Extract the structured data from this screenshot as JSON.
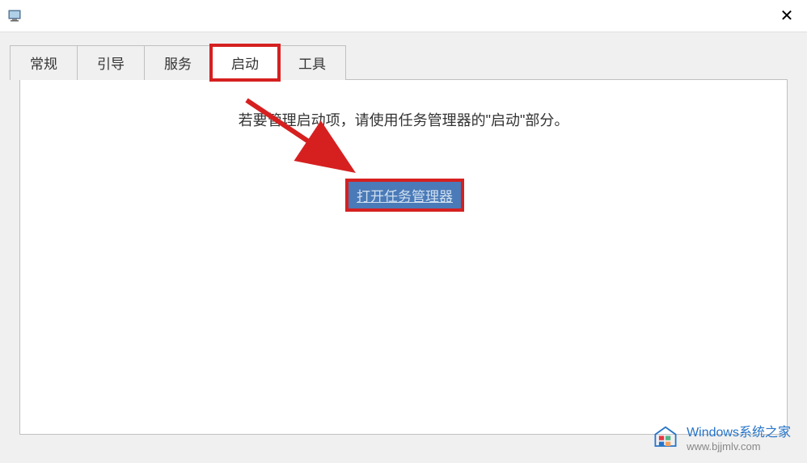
{
  "titlebar": {
    "close_label": "✕"
  },
  "tabs": {
    "general": "常规",
    "boot": "引导",
    "services": "服务",
    "startup": "启动",
    "tools": "工具"
  },
  "content": {
    "info_text": "若要管理启动项，请使用任务管理器的\"启动\"部分。",
    "link_label": "打开任务管理器"
  },
  "watermark": {
    "title": "Windows系统之家",
    "url": "www.bjjmlv.com"
  }
}
